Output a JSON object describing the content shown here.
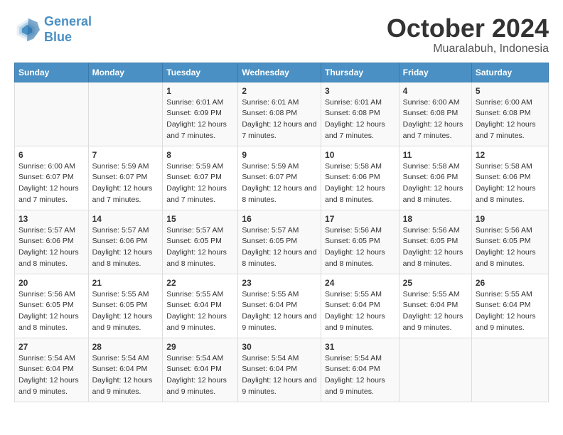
{
  "logo": {
    "line1": "General",
    "line2": "Blue"
  },
  "title": "October 2024",
  "subtitle": "Muaralabuh, Indonesia",
  "headers": [
    "Sunday",
    "Monday",
    "Tuesday",
    "Wednesday",
    "Thursday",
    "Friday",
    "Saturday"
  ],
  "weeks": [
    [
      {
        "day": "",
        "sunrise": "",
        "sunset": "",
        "daylight": ""
      },
      {
        "day": "",
        "sunrise": "",
        "sunset": "",
        "daylight": ""
      },
      {
        "day": "1",
        "sunrise": "Sunrise: 6:01 AM",
        "sunset": "Sunset: 6:09 PM",
        "daylight": "Daylight: 12 hours and 7 minutes."
      },
      {
        "day": "2",
        "sunrise": "Sunrise: 6:01 AM",
        "sunset": "Sunset: 6:08 PM",
        "daylight": "Daylight: 12 hours and 7 minutes."
      },
      {
        "day": "3",
        "sunrise": "Sunrise: 6:01 AM",
        "sunset": "Sunset: 6:08 PM",
        "daylight": "Daylight: 12 hours and 7 minutes."
      },
      {
        "day": "4",
        "sunrise": "Sunrise: 6:00 AM",
        "sunset": "Sunset: 6:08 PM",
        "daylight": "Daylight: 12 hours and 7 minutes."
      },
      {
        "day": "5",
        "sunrise": "Sunrise: 6:00 AM",
        "sunset": "Sunset: 6:08 PM",
        "daylight": "Daylight: 12 hours and 7 minutes."
      }
    ],
    [
      {
        "day": "6",
        "sunrise": "Sunrise: 6:00 AM",
        "sunset": "Sunset: 6:07 PM",
        "daylight": "Daylight: 12 hours and 7 minutes."
      },
      {
        "day": "7",
        "sunrise": "Sunrise: 5:59 AM",
        "sunset": "Sunset: 6:07 PM",
        "daylight": "Daylight: 12 hours and 7 minutes."
      },
      {
        "day": "8",
        "sunrise": "Sunrise: 5:59 AM",
        "sunset": "Sunset: 6:07 PM",
        "daylight": "Daylight: 12 hours and 7 minutes."
      },
      {
        "day": "9",
        "sunrise": "Sunrise: 5:59 AM",
        "sunset": "Sunset: 6:07 PM",
        "daylight": "Daylight: 12 hours and 8 minutes."
      },
      {
        "day": "10",
        "sunrise": "Sunrise: 5:58 AM",
        "sunset": "Sunset: 6:06 PM",
        "daylight": "Daylight: 12 hours and 8 minutes."
      },
      {
        "day": "11",
        "sunrise": "Sunrise: 5:58 AM",
        "sunset": "Sunset: 6:06 PM",
        "daylight": "Daylight: 12 hours and 8 minutes."
      },
      {
        "day": "12",
        "sunrise": "Sunrise: 5:58 AM",
        "sunset": "Sunset: 6:06 PM",
        "daylight": "Daylight: 12 hours and 8 minutes."
      }
    ],
    [
      {
        "day": "13",
        "sunrise": "Sunrise: 5:57 AM",
        "sunset": "Sunset: 6:06 PM",
        "daylight": "Daylight: 12 hours and 8 minutes."
      },
      {
        "day": "14",
        "sunrise": "Sunrise: 5:57 AM",
        "sunset": "Sunset: 6:06 PM",
        "daylight": "Daylight: 12 hours and 8 minutes."
      },
      {
        "day": "15",
        "sunrise": "Sunrise: 5:57 AM",
        "sunset": "Sunset: 6:05 PM",
        "daylight": "Daylight: 12 hours and 8 minutes."
      },
      {
        "day": "16",
        "sunrise": "Sunrise: 5:57 AM",
        "sunset": "Sunset: 6:05 PM",
        "daylight": "Daylight: 12 hours and 8 minutes."
      },
      {
        "day": "17",
        "sunrise": "Sunrise: 5:56 AM",
        "sunset": "Sunset: 6:05 PM",
        "daylight": "Daylight: 12 hours and 8 minutes."
      },
      {
        "day": "18",
        "sunrise": "Sunrise: 5:56 AM",
        "sunset": "Sunset: 6:05 PM",
        "daylight": "Daylight: 12 hours and 8 minutes."
      },
      {
        "day": "19",
        "sunrise": "Sunrise: 5:56 AM",
        "sunset": "Sunset: 6:05 PM",
        "daylight": "Daylight: 12 hours and 8 minutes."
      }
    ],
    [
      {
        "day": "20",
        "sunrise": "Sunrise: 5:56 AM",
        "sunset": "Sunset: 6:05 PM",
        "daylight": "Daylight: 12 hours and 8 minutes."
      },
      {
        "day": "21",
        "sunrise": "Sunrise: 5:55 AM",
        "sunset": "Sunset: 6:05 PM",
        "daylight": "Daylight: 12 hours and 9 minutes."
      },
      {
        "day": "22",
        "sunrise": "Sunrise: 5:55 AM",
        "sunset": "Sunset: 6:04 PM",
        "daylight": "Daylight: 12 hours and 9 minutes."
      },
      {
        "day": "23",
        "sunrise": "Sunrise: 5:55 AM",
        "sunset": "Sunset: 6:04 PM",
        "daylight": "Daylight: 12 hours and 9 minutes."
      },
      {
        "day": "24",
        "sunrise": "Sunrise: 5:55 AM",
        "sunset": "Sunset: 6:04 PM",
        "daylight": "Daylight: 12 hours and 9 minutes."
      },
      {
        "day": "25",
        "sunrise": "Sunrise: 5:55 AM",
        "sunset": "Sunset: 6:04 PM",
        "daylight": "Daylight: 12 hours and 9 minutes."
      },
      {
        "day": "26",
        "sunrise": "Sunrise: 5:55 AM",
        "sunset": "Sunset: 6:04 PM",
        "daylight": "Daylight: 12 hours and 9 minutes."
      }
    ],
    [
      {
        "day": "27",
        "sunrise": "Sunrise: 5:54 AM",
        "sunset": "Sunset: 6:04 PM",
        "daylight": "Daylight: 12 hours and 9 minutes."
      },
      {
        "day": "28",
        "sunrise": "Sunrise: 5:54 AM",
        "sunset": "Sunset: 6:04 PM",
        "daylight": "Daylight: 12 hours and 9 minutes."
      },
      {
        "day": "29",
        "sunrise": "Sunrise: 5:54 AM",
        "sunset": "Sunset: 6:04 PM",
        "daylight": "Daylight: 12 hours and 9 minutes."
      },
      {
        "day": "30",
        "sunrise": "Sunrise: 5:54 AM",
        "sunset": "Sunset: 6:04 PM",
        "daylight": "Daylight: 12 hours and 9 minutes."
      },
      {
        "day": "31",
        "sunrise": "Sunrise: 5:54 AM",
        "sunset": "Sunset: 6:04 PM",
        "daylight": "Daylight: 12 hours and 9 minutes."
      },
      {
        "day": "",
        "sunrise": "",
        "sunset": "",
        "daylight": ""
      },
      {
        "day": "",
        "sunrise": "",
        "sunset": "",
        "daylight": ""
      }
    ]
  ]
}
